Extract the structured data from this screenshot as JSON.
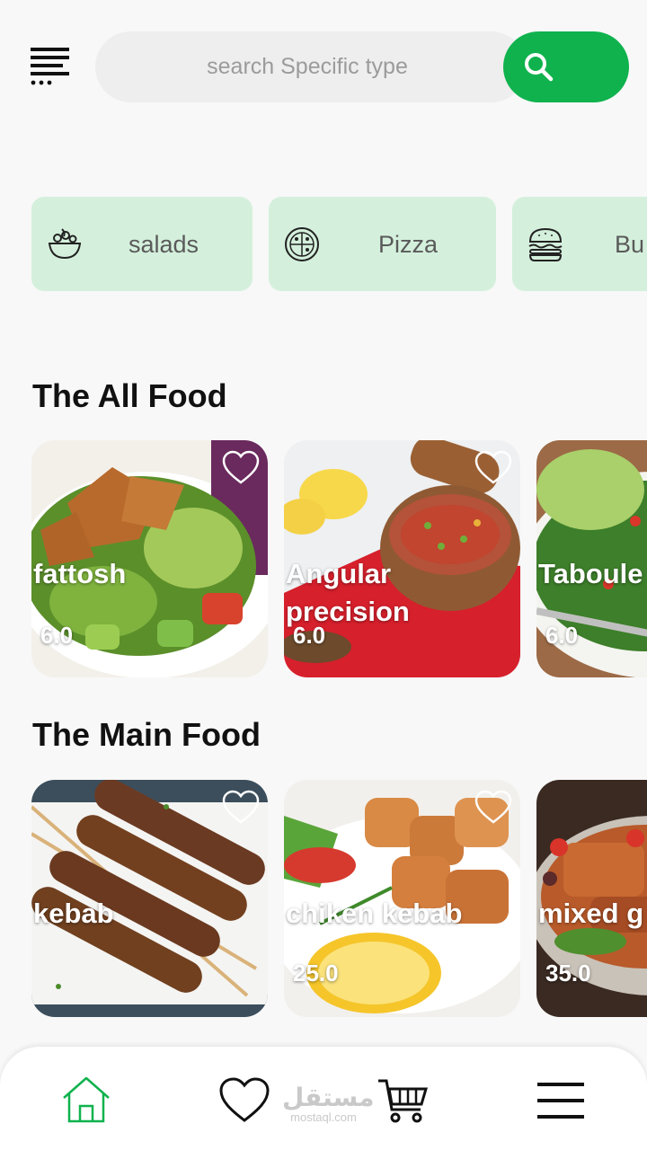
{
  "search": {
    "placeholder": "search Specific type"
  },
  "categories": [
    {
      "label": "salads",
      "icon": "salad-bowl-icon"
    },
    {
      "label": "Pizza",
      "icon": "pizza-icon"
    },
    {
      "label": "Bu",
      "icon": "burger-icon"
    }
  ],
  "sections": {
    "all_food": {
      "title": "The All Food",
      "items": [
        {
          "name": "fattosh",
          "price": "6.0"
        },
        {
          "name": "Angular precision",
          "price": "6.0"
        },
        {
          "name": "Taboule",
          "price": "6.0"
        }
      ]
    },
    "main_food": {
      "title": "The Main Food",
      "items": [
        {
          "name": "kebab",
          "price": ""
        },
        {
          "name": "chiken kebab",
          "price": "25.0"
        },
        {
          "name": "mixed g",
          "price": "35.0"
        }
      ]
    }
  },
  "bottom_nav": [
    {
      "name": "home",
      "icon": "home-icon",
      "active": true
    },
    {
      "name": "favorites",
      "icon": "heart-icon",
      "active": false
    },
    {
      "name": "cart",
      "icon": "cart-icon",
      "active": false
    },
    {
      "name": "menu",
      "icon": "hamburger-icon",
      "active": false
    }
  ],
  "watermark": {
    "arabic": "مستقل",
    "latin": "mostaql.com"
  },
  "colors": {
    "accent": "#0fb24d",
    "category_bg": "#d4f0dc",
    "background": "#f8f8f8"
  }
}
